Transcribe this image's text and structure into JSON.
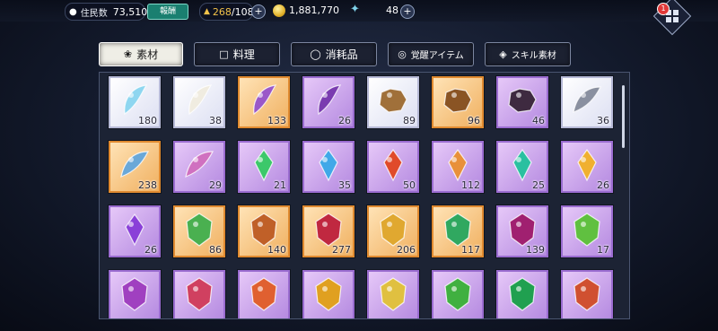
{
  "header": {
    "residents_label": "住民数",
    "residents_value": "73,510",
    "news_label": "報酬",
    "stamina": "268",
    "stamina_max": "/108",
    "gold": "1,881,770",
    "gems": "48",
    "notification_count": "1",
    "colors": {
      "stamina": "#f2c24a"
    }
  },
  "tabs": [
    {
      "label": "素材",
      "icon": "leaf-icon",
      "active": true
    },
    {
      "label": "料理",
      "icon": "pot-icon",
      "active": false
    },
    {
      "label": "消耗品",
      "icon": "potion-icon",
      "active": false
    },
    {
      "label": "覚醒アイテム",
      "icon": "awaken-icon",
      "active": false
    },
    {
      "label": "スキル素材",
      "icon": "skill-icon",
      "active": false
    }
  ],
  "items": [
    {
      "count": "180",
      "rarity": "white",
      "icon": "crystal-shard-icon",
      "color": "#8ed6f0"
    },
    {
      "count": "38",
      "rarity": "white",
      "icon": "fang-icon",
      "color": "#f0ece0"
    },
    {
      "count": "133",
      "rarity": "orange",
      "icon": "horn-icon",
      "color": "#9a58c8"
    },
    {
      "count": "26",
      "rarity": "purple",
      "icon": "claw-icon",
      "color": "#7a3cb0"
    },
    {
      "count": "89",
      "rarity": "white",
      "icon": "hide-icon",
      "color": "#a0703a"
    },
    {
      "count": "96",
      "rarity": "orange",
      "icon": "pelt-icon",
      "color": "#8a5424"
    },
    {
      "count": "46",
      "rarity": "purple",
      "icon": "dark-pelt-icon",
      "color": "#3e2a40"
    },
    {
      "count": "36",
      "rarity": "white",
      "icon": "feather-cluster-icon",
      "color": "#8a90a0"
    },
    {
      "count": "238",
      "rarity": "orange",
      "icon": "blue-feathers-icon",
      "color": "#6aa8d8"
    },
    {
      "count": "29",
      "rarity": "purple",
      "icon": "rainbow-feathers-icon",
      "color": "#d070c0"
    },
    {
      "count": "21",
      "rarity": "purple",
      "icon": "green-gem-icon",
      "color": "#3cc86a"
    },
    {
      "count": "35",
      "rarity": "purple",
      "icon": "blue-gem-icon",
      "color": "#40a8e8"
    },
    {
      "count": "50",
      "rarity": "purple",
      "icon": "red-gem-icon",
      "color": "#e04a2a"
    },
    {
      "count": "112",
      "rarity": "purple",
      "icon": "amber-gem-icon",
      "color": "#e8903a"
    },
    {
      "count": "25",
      "rarity": "purple",
      "icon": "teal-gem-icon",
      "color": "#2ac0a0"
    },
    {
      "count": "26",
      "rarity": "purple",
      "icon": "gold-gem-icon",
      "color": "#f0b030"
    },
    {
      "count": "26",
      "rarity": "purple",
      "icon": "violet-gem-icon",
      "color": "#8a40d8"
    },
    {
      "count": "86",
      "rarity": "orange",
      "icon": "green-crest-icon",
      "color": "#4ab050"
    },
    {
      "count": "140",
      "rarity": "orange",
      "icon": "copper-crest-icon",
      "color": "#c06028"
    },
    {
      "count": "277",
      "rarity": "orange",
      "icon": "crimson-crest-icon",
      "color": "#c02840"
    },
    {
      "count": "206",
      "rarity": "orange",
      "icon": "gold-crest-icon",
      "color": "#e0a830"
    },
    {
      "count": "117",
      "rarity": "orange",
      "icon": "emerald-crest-icon",
      "color": "#30a860"
    },
    {
      "count": "139",
      "rarity": "purple",
      "icon": "ruby-crest-icon",
      "color": "#a02070"
    },
    {
      "count": "17",
      "rarity": "purple",
      "icon": "jade-crest-icon",
      "color": "#60c040"
    },
    {
      "count": "",
      "rarity": "purple",
      "icon": "amethyst-crest-icon",
      "color": "#a040c0"
    },
    {
      "count": "",
      "rarity": "purple",
      "icon": "rose-crest-icon",
      "color": "#d04060"
    },
    {
      "count": "",
      "rarity": "purple",
      "icon": "flame-crest-icon",
      "color": "#e06030"
    },
    {
      "count": "",
      "rarity": "purple",
      "icon": "sun-crest-icon",
      "color": "#e0a020"
    },
    {
      "count": "",
      "rarity": "purple",
      "icon": "topaz-crest-icon",
      "color": "#e0c040"
    },
    {
      "count": "",
      "rarity": "purple",
      "icon": "leaf-crest-icon",
      "color": "#40b040"
    },
    {
      "count": "",
      "rarity": "purple",
      "icon": "forest-crest-icon",
      "color": "#20a050"
    },
    {
      "count": "",
      "rarity": "purple",
      "icon": "golem-icon",
      "color": "#d05030"
    }
  ]
}
